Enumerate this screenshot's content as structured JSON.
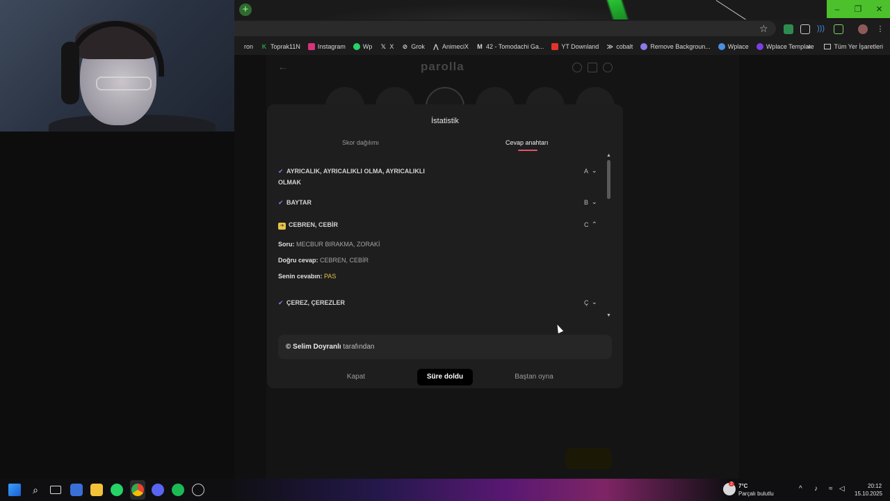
{
  "bookmarks": [
    {
      "label": "ron",
      "icon": "bookmark-icon",
      "color": "#4a4a4a"
    },
    {
      "label": "Toprak11N",
      "icon": "k-icon",
      "color": "#2f9a43"
    },
    {
      "label": "Instagram",
      "icon": "instagram-icon",
      "color": "#d6337b"
    },
    {
      "label": "Wp",
      "icon": "whatsapp-icon",
      "color": "#25d366"
    },
    {
      "label": "X",
      "icon": "x-icon",
      "color": "#ffffff"
    },
    {
      "label": "Grok",
      "icon": "grok-icon",
      "color": "#dddddd"
    },
    {
      "label": "AnimeciX",
      "icon": "animecix-icon",
      "color": "#bbbbbb"
    },
    {
      "label": "42 - Tomodachi Ga...",
      "icon": "gmail-icon",
      "color": "#ffffff"
    },
    {
      "label": "YT Downland",
      "icon": "yt-icon",
      "color": "#e2342b"
    },
    {
      "label": "cobalt",
      "icon": "cobalt-icon",
      "color": "#ffffff"
    },
    {
      "label": "Remove Backgroun...",
      "icon": "remove-bg-icon",
      "color": "#8a7ae6"
    },
    {
      "label": "Wplace",
      "icon": "globe-icon",
      "color": "#4a90e2"
    },
    {
      "label": "Wplace Template",
      "icon": "wplace-template-icon",
      "color": "#7b3fe4"
    }
  ],
  "bookmarks_more": "»",
  "bookmarks_all": "Tüm Yer İşaretleri",
  "page": {
    "logo": "parolla"
  },
  "modal": {
    "title": "İstatistik",
    "tabs": [
      {
        "label": "Skor dağılımı"
      },
      {
        "label": "Cevap anahtarı"
      }
    ],
    "rows": [
      {
        "mark": "✔",
        "text_line1": "AYRICALIK, AYRICALIKLI OLMA, AYRICALIKLI",
        "text_line2": "OLMAK",
        "letter": "A",
        "chevron": "⌄"
      },
      {
        "mark": "✔",
        "text_line1": "BAYTAR",
        "letter": "B",
        "chevron": "⌄"
      },
      {
        "mark": "➔",
        "text_line1": "CEBREN, CEBİR",
        "letter": "C",
        "chevron": "⌃"
      },
      {
        "mark": "✔",
        "text_line1": "ÇEREZ, ÇEREZLER",
        "letter": "Ç",
        "chevron": "⌄"
      }
    ],
    "detail": {
      "question_label": "Soru:",
      "question_value": "MECBUR BIRAKMA, ZORAKİ",
      "answer_label": "Doğru cevap:",
      "answer_value": "CEBREN, CEBİR",
      "your_label": "Senin cevabın:",
      "your_value": "PAS"
    },
    "credit_prefix": "©",
    "credit_name": "Selim Doyranlı",
    "credit_suffix": "tarafından",
    "buttons": {
      "close": "Kapat",
      "time_up": "Süre doldu",
      "restart": "Baştan oyna"
    }
  },
  "taskbar": {
    "weather_temp": "7°C",
    "weather_desc": "Parçalı bulutlu",
    "weather_badge": "2",
    "time": "20:12",
    "date": "15.10.2025"
  },
  "colors": {
    "accent_underline": "#e0566b",
    "pass_yellow": "#e6c34a",
    "check_purple": "#8a7ae6",
    "chrome_green": "#4cc12c"
  }
}
